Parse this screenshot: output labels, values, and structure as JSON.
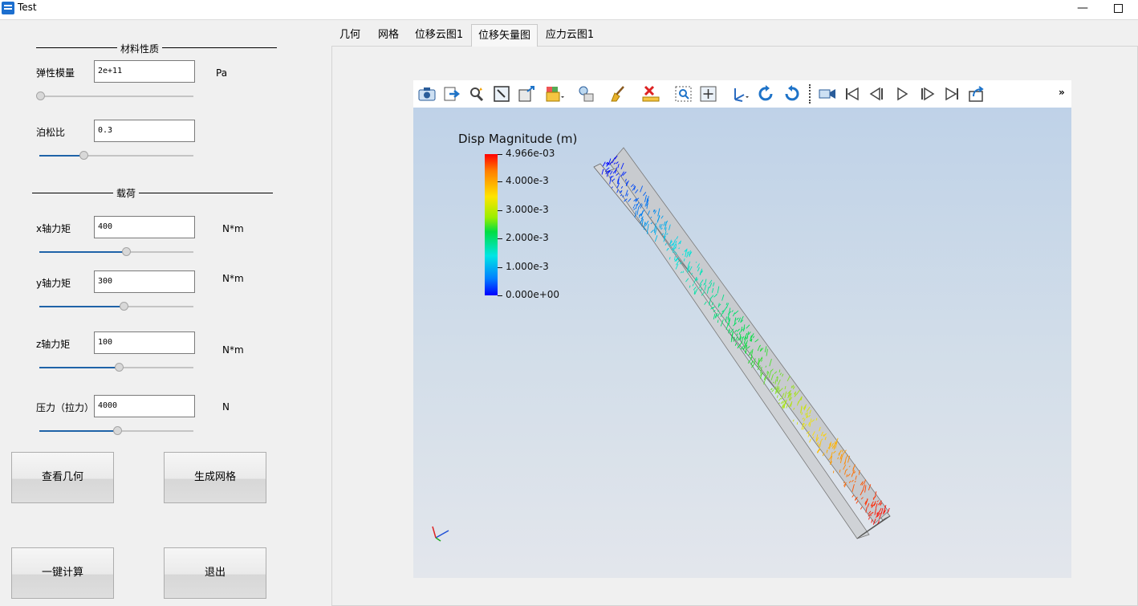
{
  "window": {
    "title": "Test"
  },
  "material": {
    "section_title": "材料性质",
    "elastic_modulus": {
      "label": "弹性模量",
      "value": "2e+11",
      "unit": "Pa",
      "slider_fraction": 0.0
    },
    "poisson_ratio": {
      "label": "泊松比",
      "value": "0.3",
      "slider_fraction": 0.29
    }
  },
  "load": {
    "section_title": "载荷",
    "x_moment": {
      "label": "x轴力矩",
      "value": "400",
      "unit": "N*m",
      "slider_fraction": 0.57
    },
    "y_moment": {
      "label": "y轴力矩",
      "value": "300",
      "unit": "N*m",
      "slider_fraction": 0.55
    },
    "z_moment": {
      "label": "z轴力矩",
      "value": "100",
      "unit": "N*m",
      "slider_fraction": 0.52
    },
    "pressure": {
      "label": "压力（拉力）",
      "value": "4000",
      "unit": "N",
      "slider_fraction": 0.51
    }
  },
  "buttons": {
    "view_geometry": "查看几何",
    "generate_mesh": "生成网格",
    "compute_all": "一键计算",
    "exit": "退出"
  },
  "tabs": [
    {
      "label": "几何"
    },
    {
      "label": "网格"
    },
    {
      "label": "位移云图1"
    },
    {
      "label": "位移矢量图",
      "active": true
    },
    {
      "label": "应力云图1"
    }
  ],
  "toolbar": {
    "icons": [
      "camera-icon",
      "export-icon",
      "probe-icon",
      "pick-icon",
      "box-icon",
      "render-mode-icon",
      "light-icon",
      "clean-icon",
      "delete-icon",
      "zoom-box-icon",
      "fit-icon",
      "axes-icon",
      "rotate-cw-icon",
      "rotate-ccw-icon",
      "video-camera-icon",
      "first-frame-icon",
      "prev-frame-icon",
      "play-icon",
      "next-frame-icon",
      "last-frame-icon",
      "export-animation-icon"
    ],
    "overflow_label": "»"
  },
  "legend": {
    "title": "Disp Magnitude (m)",
    "labels": [
      "4.966e-03",
      "4.000e-3",
      "3.000e-3",
      "2.000e-3",
      "1.000e-3",
      "0.000e+00"
    ],
    "values": [
      0.004966,
      0.004,
      0.003,
      0.002,
      0.001,
      0.0
    ],
    "min": 0.0,
    "max": 0.004966,
    "colormap": [
      "#0000ff",
      "#00e5e5",
      "#00dd44",
      "#ffe400",
      "#ff0000"
    ]
  },
  "colors": {
    "accent": "#1f63a8",
    "panel": "#f0f0f0",
    "render_top": "#bfd2e8",
    "render_bottom": "#e3e6ec"
  }
}
